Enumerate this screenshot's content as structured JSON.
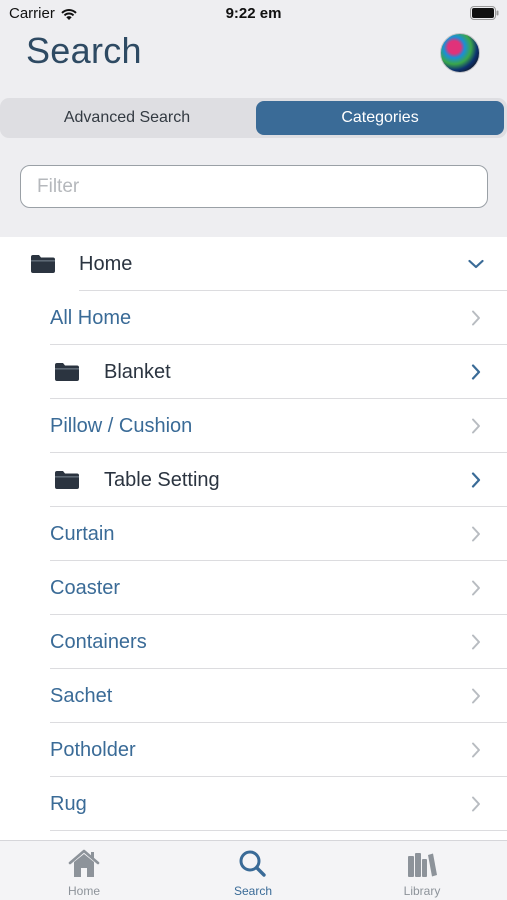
{
  "status_bar": {
    "carrier": "Carrier",
    "time": "9:22 em"
  },
  "header": {
    "title": "Search"
  },
  "segments": {
    "advanced": "Advanced Search",
    "categories": "Categories",
    "selected": "Categories"
  },
  "filter": {
    "placeholder": "Filter",
    "value": ""
  },
  "categories": [
    {
      "label": "Home",
      "kind": "folder",
      "expanded": true
    },
    {
      "label": "All Home",
      "kind": "item"
    },
    {
      "label": "Blanket",
      "kind": "folder"
    },
    {
      "label": "Pillow / Cushion",
      "kind": "item"
    },
    {
      "label": "Table Setting",
      "kind": "folder"
    },
    {
      "label": "Curtain",
      "kind": "item"
    },
    {
      "label": "Coaster",
      "kind": "item"
    },
    {
      "label": "Containers",
      "kind": "item"
    },
    {
      "label": "Sachet",
      "kind": "item"
    },
    {
      "label": "Potholder",
      "kind": "item"
    },
    {
      "label": "Rug",
      "kind": "item"
    }
  ],
  "tab_bar": {
    "tabs": [
      {
        "label": "Home",
        "icon": "home-icon"
      },
      {
        "label": "Search",
        "icon": "search-icon",
        "active": true
      },
      {
        "label": "Library",
        "icon": "library-icon"
      }
    ]
  },
  "colors": {
    "accent": "#3a6b97",
    "folder": "#2b3440",
    "background": "#eeeef1"
  }
}
